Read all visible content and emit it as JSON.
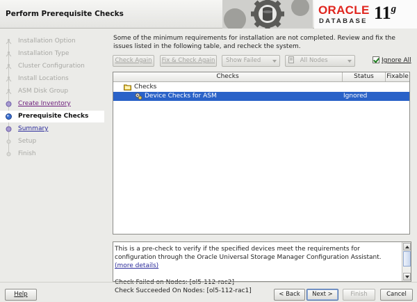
{
  "window": {
    "title": "Perform Prerequisite Checks"
  },
  "brand": {
    "oracle": "ORACLE",
    "database": "DATABASE",
    "version": "11",
    "version_suffix": "g"
  },
  "steps": [
    {
      "label": "Installation Option",
      "state": "done"
    },
    {
      "label": "Installation Type",
      "state": "done"
    },
    {
      "label": "Cluster Configuration",
      "state": "done"
    },
    {
      "label": "Install Locations",
      "state": "done"
    },
    {
      "label": "ASM Disk Group",
      "state": "done"
    },
    {
      "label": "Create Inventory",
      "state": "visited"
    },
    {
      "label": "Prerequisite Checks",
      "state": "current"
    },
    {
      "label": "Summary",
      "state": "link"
    },
    {
      "label": "Setup",
      "state": "future"
    },
    {
      "label": "Finish",
      "state": "future"
    }
  ],
  "main": {
    "description": "Some of the minimum requirements for installation are not completed. Review and fix the issues listed in the following table, and recheck the system."
  },
  "toolbar": {
    "check_again": "Check Again",
    "fix_check_again": "Fix & Check Again",
    "show_filter": "Show Failed",
    "nodes_filter": "All Nodes",
    "ignore_all": "Ignore All"
  },
  "table": {
    "columns": {
      "checks": "Checks",
      "status": "Status",
      "fixable": "Fixable"
    },
    "root": {
      "label": "Checks"
    },
    "rows": [
      {
        "label": "Device Checks for ASM",
        "status": "Ignored",
        "fixable": ""
      }
    ]
  },
  "details": {
    "text": "This is a pre-check to verify if the specified devices meet the requirements for configuration through the Oracle Universal Storage Manager Configuration Assistant.",
    "link": "(more details)",
    "failed": "Check Failed on Nodes: [ol5-112-rac2]",
    "succeeded": "Check Succeeded On Nodes: [ol5-112-rac1]"
  },
  "footer": {
    "help": "Help",
    "back": "< Back",
    "next": "Next >",
    "finish": "Finish",
    "cancel": "Cancel"
  },
  "colors": {
    "selection": "#2a62c8",
    "oracle_red": "#e0241d",
    "current_step_dot": "#3a6fd0"
  }
}
